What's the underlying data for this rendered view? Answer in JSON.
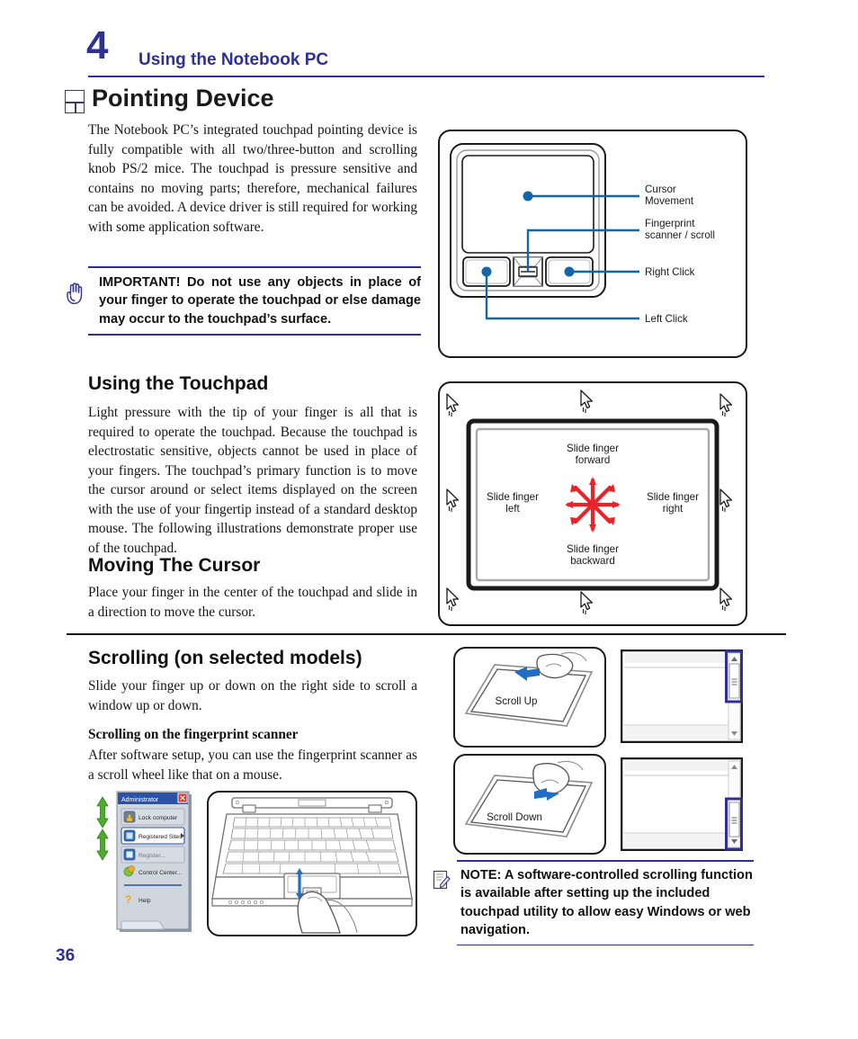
{
  "header": {
    "chapter_number": "4",
    "chapter_title": "Using the Notebook PC",
    "rule_color": "#2e3192"
  },
  "section": {
    "icon": "quad-square-icon",
    "title": "Pointing Device",
    "intro_paragraph": "The Notebook PC’s integrated touchpad pointing device is fully compatible with all two/three-button and scrolling knob PS/2 mice. The touchpad is pressure sensitive and contains no moving parts; therefore, mechanical failures can be avoided. A device driver is still required for working with some application software."
  },
  "important_callout": {
    "icon": "hand-stop-icon",
    "text": "IMPORTANT! Do not use any objects in place of your finger to operate the touchpad or else damage may occur to the touchpad’s surface.",
    "rule_color": "#2e3192"
  },
  "using_touchpad": {
    "heading": "Using the Touchpad",
    "paragraph": "Light pressure with the tip of your finger is all that is required to operate the touchpad. Because the touchpad is electrostatic sensitive, objects cannot be used in place of your fingers. The touchpad’s primary function is to move the cursor around or select items displayed on the screen with the use of your fingertip instead of a standard desktop mouse. The following illustrations demonstrate proper use of the touchpad."
  },
  "moving_cursor": {
    "heading": "Moving The Cursor",
    "paragraph": "Place your finger in the center of the touchpad and slide in a direction to move the cursor."
  },
  "scrolling": {
    "heading": "Scrolling (on selected models)",
    "paragraph": "Slide your finger up or down on the right side to scroll a window up or down.",
    "sub_heading": "Scrolling on the fingerprint scanner",
    "sub_paragraph": "After software setup, you can use the fingerprint scanner as a scroll wheel like that on a mouse."
  },
  "note_callout": {
    "icon": "note-pencil-icon",
    "text": "NOTE: A software-controlled scrolling function is available after setting up the included touchpad utility to allow easy Windows or web navigation.",
    "rule_color": "#2e3192"
  },
  "figures": {
    "touchpad_callouts": {
      "name": "touchpad-callout-diagram",
      "labels": {
        "cursor_movement_line1": "Cursor",
        "cursor_movement_line2": "Movement",
        "fingerprint_line1": "Fingerprint",
        "fingerprint_line2": "scanner / scroll",
        "right_click": "Right Click",
        "left_click": "Left Click"
      },
      "accent_color": "#1565a8"
    },
    "slide_directions": {
      "name": "slide-finger-diagram",
      "labels": {
        "forward_line1": "Slide finger",
        "forward_line2": "forward",
        "backward_line1": "Slide finger",
        "backward_line2": "backward",
        "left_line1": "Slide finger",
        "left_line2": "left",
        "right_line1": "Slide finger",
        "right_line2": "right"
      },
      "arrow_color": "#e8242a"
    },
    "scroll_up": {
      "name": "scroll-up-diagram",
      "label": "Scroll Up",
      "arrow_color": "#1f6fc4"
    },
    "scroll_down": {
      "name": "scroll-down-diagram",
      "label": "Scroll Down",
      "arrow_color": "#1f6fc4"
    },
    "scroll_window_up": {
      "name": "scroll-window-up",
      "highlight_color": "#2e3192",
      "thumb_position": "top"
    },
    "scroll_window_down": {
      "name": "scroll-window-down",
      "highlight_color": "#2e3192",
      "thumb_position": "bottom"
    },
    "admin_menu": {
      "name": "administrator-menu-screenshot",
      "title": "Administrator",
      "items": [
        "Lock computer",
        "Registered Sites",
        "Register...",
        "Control Center...",
        "Help"
      ],
      "title_bar_color": "#2a53a8",
      "arrow_color": "#4caf2a"
    },
    "laptop": {
      "name": "laptop-fingerprint-scroll-illustration",
      "arrow_color": "#1f6fc4"
    }
  },
  "footer": {
    "page_number": "36",
    "color": "#2e3192"
  }
}
